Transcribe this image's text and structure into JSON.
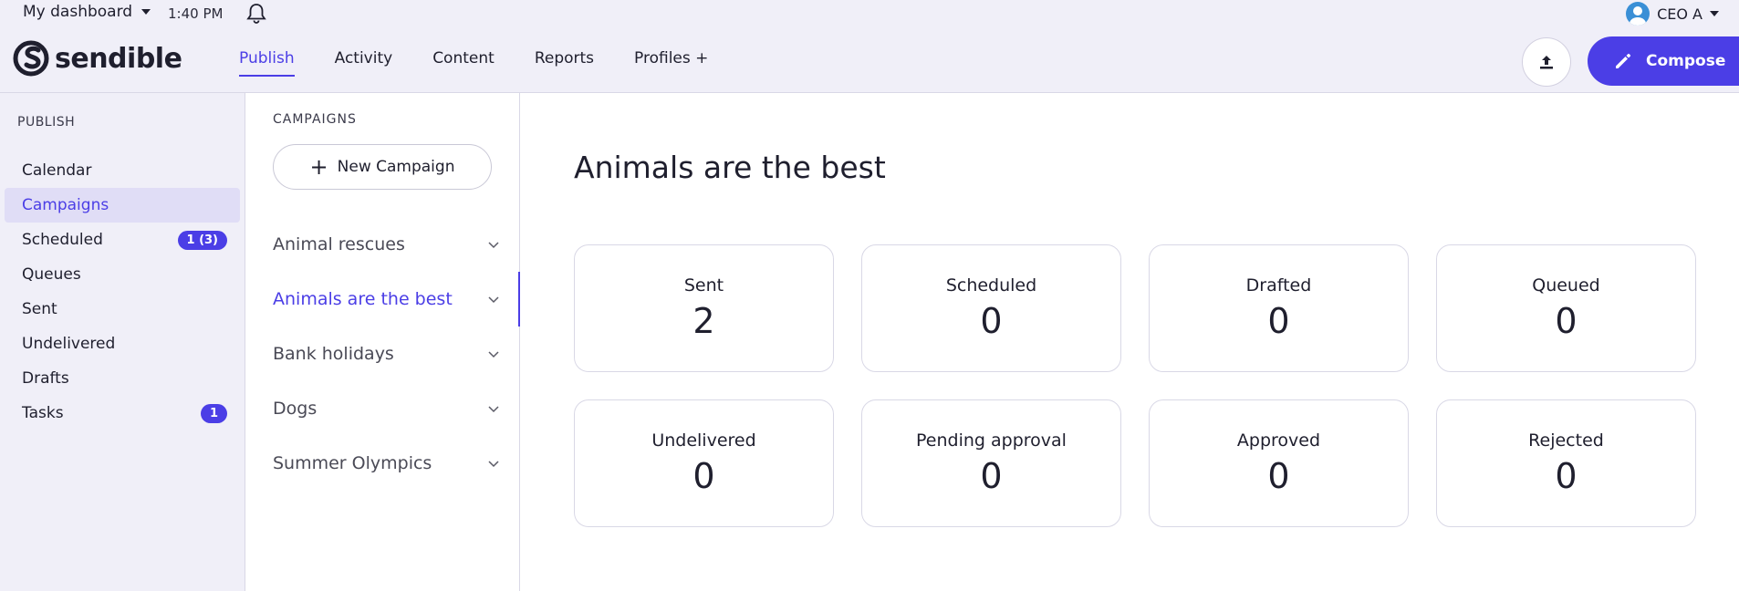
{
  "topbar": {
    "dashboard_label": "My dashboard",
    "time": "1:40 PM",
    "user_name": "CEO A",
    "logo_text": "sendible"
  },
  "nav": {
    "items": [
      {
        "label": "Publish",
        "active": true
      },
      {
        "label": "Activity"
      },
      {
        "label": "Content"
      },
      {
        "label": "Reports"
      },
      {
        "label": "Profiles +"
      }
    ]
  },
  "actions": {
    "compose_label": "Compose"
  },
  "sidebar": {
    "heading": "PUBLISH",
    "items": [
      {
        "label": "Calendar"
      },
      {
        "label": "Campaigns",
        "active": true
      },
      {
        "label": "Scheduled",
        "badge": "1 (3)"
      },
      {
        "label": "Queues"
      },
      {
        "label": "Sent"
      },
      {
        "label": "Undelivered"
      },
      {
        "label": "Drafts"
      },
      {
        "label": "Tasks",
        "badge": "1"
      }
    ]
  },
  "campaigns": {
    "heading": "CAMPAIGNS",
    "new_label": "New Campaign",
    "items": [
      {
        "label": "Animal rescues"
      },
      {
        "label": "Animals are the best",
        "active": true
      },
      {
        "label": "Bank holidays"
      },
      {
        "label": "Dogs"
      },
      {
        "label": "Summer Olympics"
      }
    ]
  },
  "main": {
    "title": "Animals are the best",
    "stats": [
      {
        "label": "Sent",
        "value": "2"
      },
      {
        "label": "Scheduled",
        "value": "0"
      },
      {
        "label": "Drafted",
        "value": "0"
      },
      {
        "label": "Queued",
        "value": "0"
      },
      {
        "label": "Undelivered",
        "value": "0"
      },
      {
        "label": "Pending approval",
        "value": "0"
      },
      {
        "label": "Approved",
        "value": "0"
      },
      {
        "label": "Rejected",
        "value": "0"
      }
    ]
  },
  "colors": {
    "accent": "#4b3ee6",
    "chrome_bg": "#f0eff8",
    "border": "#d9d8e6"
  }
}
